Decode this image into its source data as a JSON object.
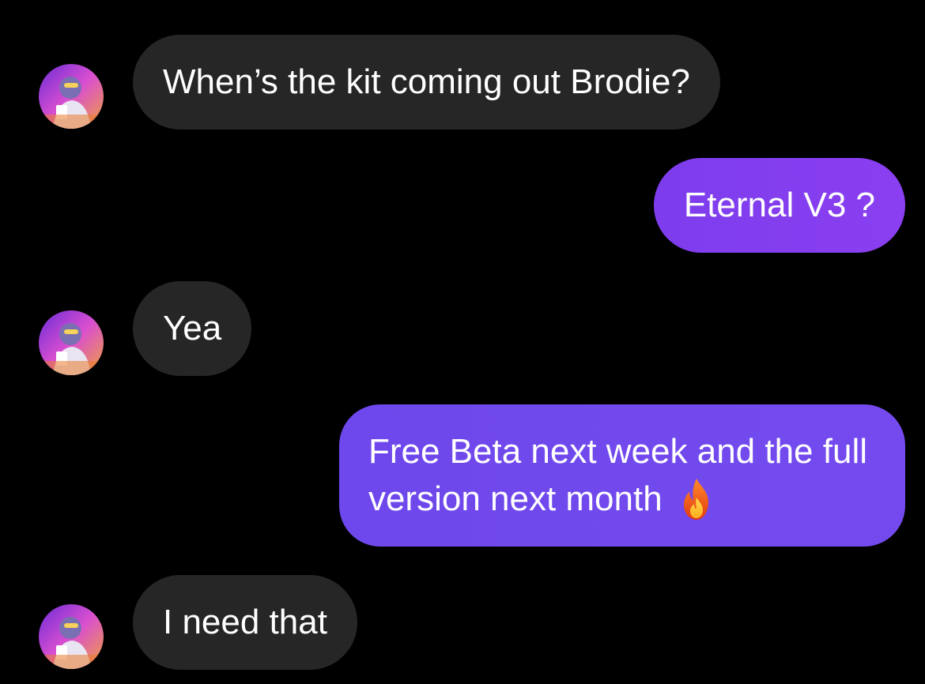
{
  "thread": {
    "messages": [
      {
        "direction": "incoming",
        "text": "When’s the kit coming out Brodie?"
      },
      {
        "direction": "outgoing",
        "text": "Eternal V3 ?"
      },
      {
        "direction": "incoming",
        "text": "Yea"
      },
      {
        "direction": "outgoing",
        "lines": [
          "Free Beta next week and the full",
          "version next month"
        ],
        "emoji": "fire-emoji"
      },
      {
        "direction": "incoming",
        "text": "I need that"
      }
    ]
  },
  "colors": {
    "background": "#000000",
    "incoming_bubble": "#262626",
    "outgoing_bubble_start": "#7d3ded",
    "outgoing_bubble_end": "#744aee",
    "text": "#ffffff"
  },
  "icons": {
    "avatar": "sender-avatar",
    "emoji": "fire-emoji"
  }
}
